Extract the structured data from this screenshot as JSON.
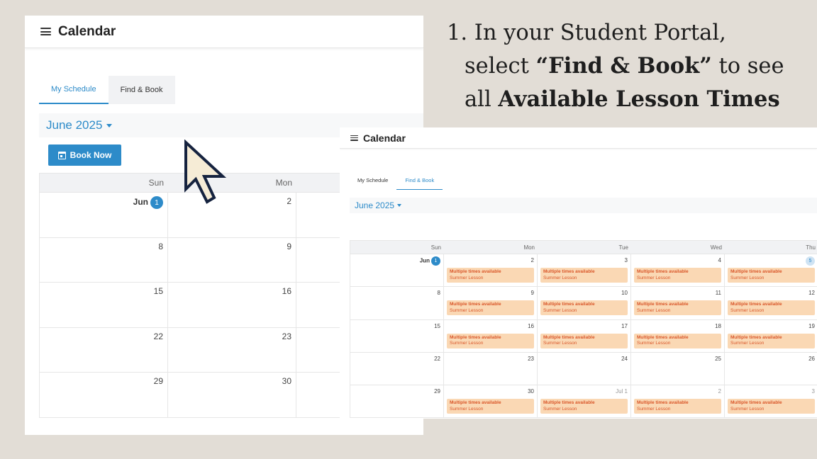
{
  "back": {
    "title": "Calendar",
    "tabs": [
      "My Schedule",
      "Find & Book"
    ],
    "month": "June 2025",
    "book_now": "Book Now",
    "dow": [
      "Sun",
      "Mon"
    ],
    "weeks": [
      [
        "Jun",
        "2"
      ],
      [
        "8",
        "9"
      ],
      [
        "15",
        "16"
      ],
      [
        "22",
        "23"
      ],
      [
        "29",
        "30"
      ]
    ],
    "first_badge": "1"
  },
  "front": {
    "title": "Calendar",
    "tabs": [
      "My Schedule",
      "Find & Book"
    ],
    "month": "June 2025",
    "dow": [
      "Sun",
      "Mon",
      "Tue",
      "Wed",
      "Thu"
    ],
    "weeks": [
      [
        {
          "label": "Jun",
          "badge": "1",
          "ev": false
        },
        {
          "label": "2",
          "ev": true
        },
        {
          "label": "3",
          "ev": true
        },
        {
          "label": "4",
          "ev": true
        },
        {
          "label": "",
          "badge": "5",
          "light": true,
          "ev": true
        }
      ],
      [
        {
          "label": "8",
          "ev": false
        },
        {
          "label": "9",
          "ev": true
        },
        {
          "label": "10",
          "ev": true
        },
        {
          "label": "11",
          "ev": true
        },
        {
          "label": "12",
          "ev": true
        }
      ],
      [
        {
          "label": "15",
          "ev": false
        },
        {
          "label": "16",
          "ev": true
        },
        {
          "label": "17",
          "ev": true
        },
        {
          "label": "18",
          "ev": true
        },
        {
          "label": "19",
          "ev": true
        }
      ],
      [
        {
          "label": "22",
          "ev": false
        },
        {
          "label": "23",
          "ev": false
        },
        {
          "label": "24",
          "ev": false
        },
        {
          "label": "25",
          "ev": false
        },
        {
          "label": "26",
          "ev": false
        }
      ],
      [
        {
          "label": "29",
          "ev": false
        },
        {
          "label": "30",
          "ev": true
        },
        {
          "label": "Jul  1",
          "dim": true,
          "ev": true
        },
        {
          "label": "2",
          "dim": true,
          "ev": true
        },
        {
          "label": "3",
          "dim": true,
          "ev": true
        }
      ]
    ],
    "event_title": "Multiple times available",
    "event_subtitle": "Summer Lesson"
  },
  "instruction": {
    "line1": "1. In your Student Portal,",
    "line2_a": "select ",
    "line2_b": "“Find & Book”",
    "line2_c": " to see",
    "line3_a": "all ",
    "line3_b": "Available Lesson Times"
  },
  "colors": {
    "accent": "#2d8bc9",
    "event_bg": "#fad8b4",
    "event_text": "#d9572a",
    "background": "#e2ddd6"
  }
}
